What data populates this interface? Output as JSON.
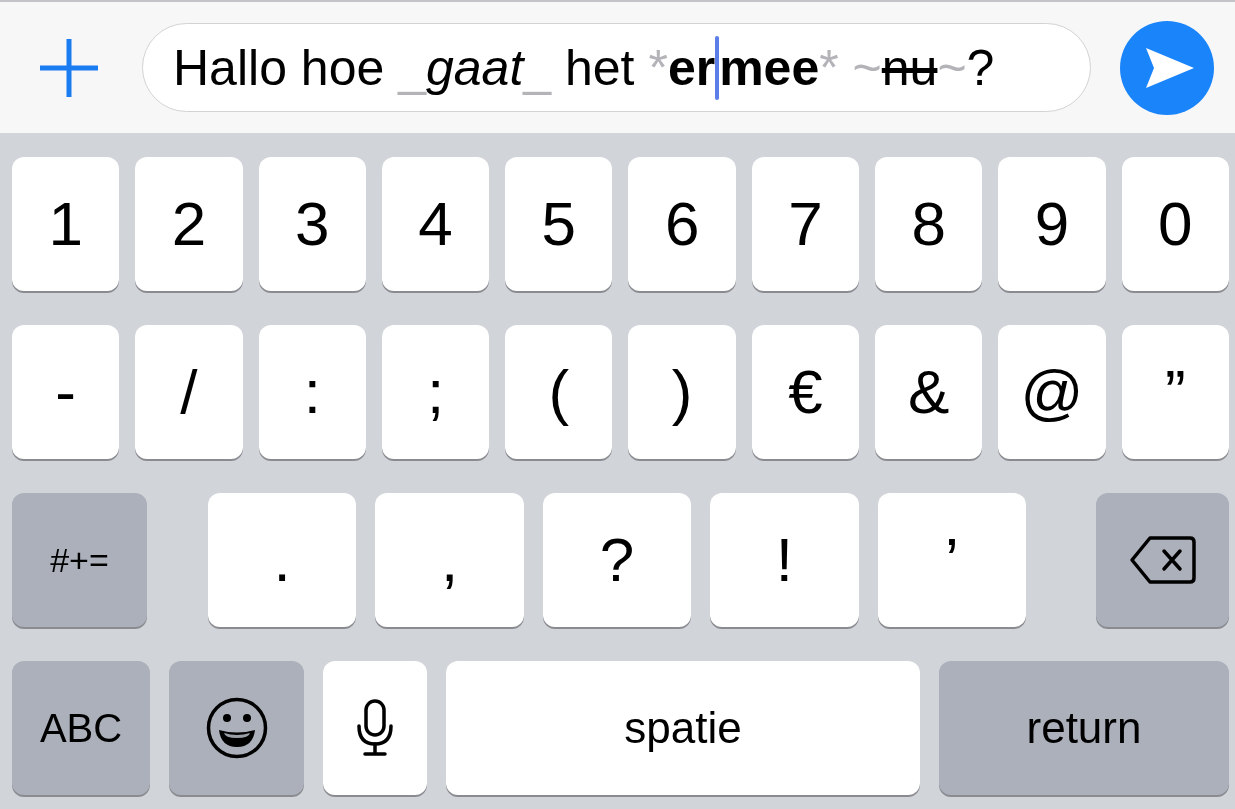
{
  "composer": {
    "message": [
      {
        "text": "Hallo hoe ",
        "kind": "plain"
      },
      {
        "text": "_",
        "kind": "marker"
      },
      {
        "text": "gaat",
        "kind": "italic"
      },
      {
        "text": "_",
        "kind": "marker"
      },
      {
        "text": " het ",
        "kind": "plain"
      },
      {
        "text": "*",
        "kind": "marker"
      },
      {
        "text": "er",
        "kind": "bold"
      },
      {
        "kind": "cursor"
      },
      {
        "text": "mee",
        "kind": "bold"
      },
      {
        "text": "* ~",
        "kind": "marker"
      },
      {
        "text": "nu",
        "kind": "strike"
      },
      {
        "text": "~",
        "kind": "marker"
      },
      {
        "text": "?",
        "kind": "plain"
      }
    ]
  },
  "keyboard": {
    "rows": [
      {
        "keys": [
          {
            "label": "1",
            "kind": "char"
          },
          {
            "label": "2",
            "kind": "char"
          },
          {
            "label": "3",
            "kind": "char"
          },
          {
            "label": "4",
            "kind": "char"
          },
          {
            "label": "5",
            "kind": "char"
          },
          {
            "label": "6",
            "kind": "char"
          },
          {
            "label": "7",
            "kind": "char"
          },
          {
            "label": "8",
            "kind": "char"
          },
          {
            "label": "9",
            "kind": "char"
          },
          {
            "label": "0",
            "kind": "char"
          }
        ]
      },
      {
        "keys": [
          {
            "label": "-",
            "kind": "char"
          },
          {
            "label": "/",
            "kind": "char"
          },
          {
            "label": ":",
            "kind": "char"
          },
          {
            "label": ";",
            "kind": "char"
          },
          {
            "label": "(",
            "kind": "char"
          },
          {
            "label": ")",
            "kind": "char"
          },
          {
            "label": "€",
            "kind": "char"
          },
          {
            "label": "&",
            "kind": "char"
          },
          {
            "label": "@",
            "kind": "char"
          },
          {
            "label": "”",
            "kind": "char"
          }
        ]
      },
      {
        "keys": [
          {
            "label": "#+=",
            "kind": "shift"
          },
          {
            "label": ".",
            "kind": "char"
          },
          {
            "label": ",",
            "kind": "char"
          },
          {
            "label": "?",
            "kind": "char"
          },
          {
            "label": "!",
            "kind": "char"
          },
          {
            "label": "’",
            "kind": "char"
          },
          {
            "kind": "delete"
          }
        ]
      },
      {
        "keys": [
          {
            "label": "ABC",
            "kind": "mode"
          },
          {
            "kind": "emoji"
          },
          {
            "kind": "mic"
          },
          {
            "label": "spatie",
            "kind": "space"
          },
          {
            "label": "return",
            "kind": "return"
          }
        ]
      }
    ]
  }
}
